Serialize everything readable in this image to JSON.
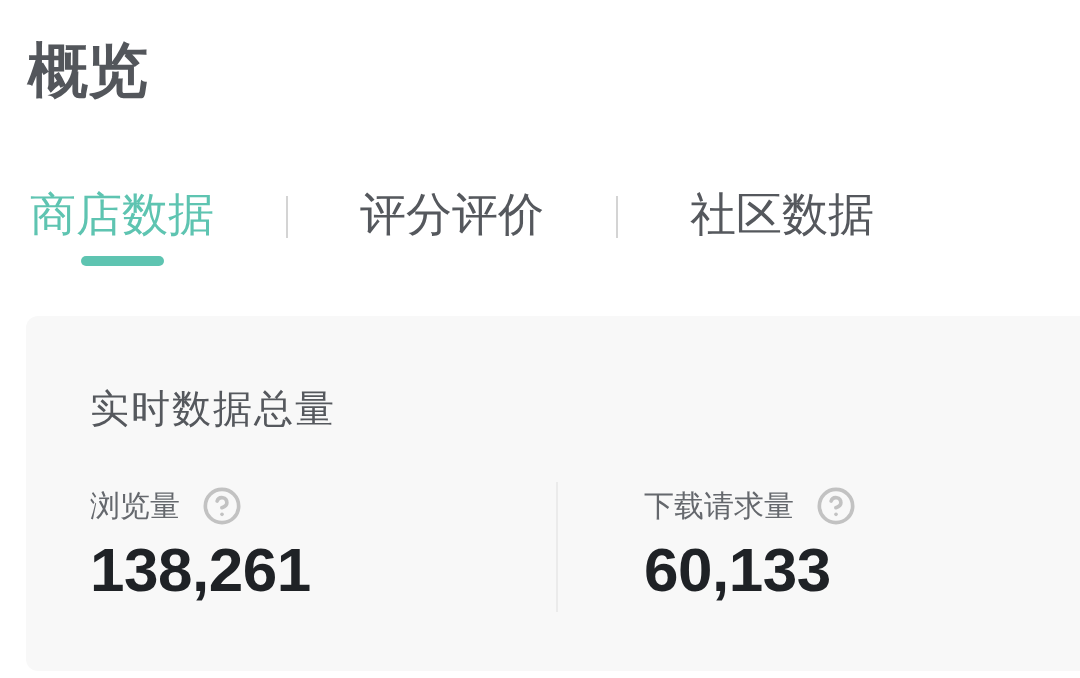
{
  "page_title": "概览",
  "tabs": [
    {
      "label": "商店数据",
      "selected": true
    },
    {
      "label": "评分评价",
      "selected": false
    },
    {
      "label": "社区数据",
      "selected": false
    }
  ],
  "summary_card": {
    "title": "实时数据总量",
    "metrics": [
      {
        "label": "浏览量",
        "value": "138,261"
      },
      {
        "label": "下载请求量",
        "value": "60,133"
      }
    ]
  }
}
